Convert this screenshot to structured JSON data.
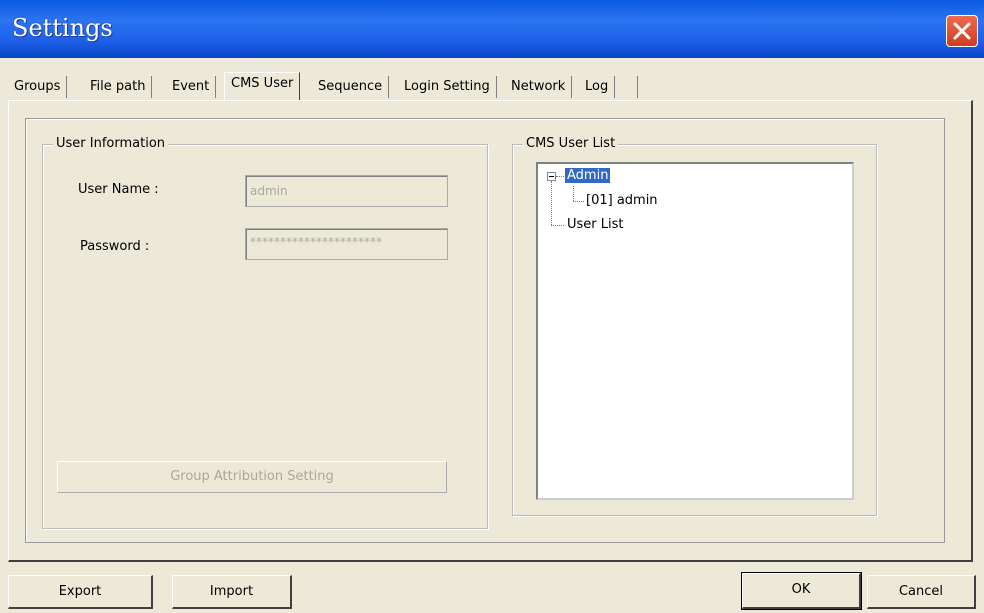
{
  "window": {
    "title": "Settings"
  },
  "tabs": [
    "Groups",
    "File path",
    "Event",
    "CMS User",
    "Sequence",
    "Login Setting",
    "Network",
    "Log"
  ],
  "active_tab": "CMS User",
  "user_info": {
    "legend": "User Information",
    "username_label": "User Name :",
    "username_value": "admin",
    "password_label": "Password :",
    "password_value": "**********************",
    "group_button": "Group Attribution Setting"
  },
  "user_list": {
    "legend": "CMS User List",
    "tree": {
      "root": "Admin",
      "child": "[01] admin",
      "sibling": "User List"
    }
  },
  "footer": {
    "export": "Export",
    "import": "Import",
    "ok": "OK",
    "cancel": "Cancel"
  }
}
